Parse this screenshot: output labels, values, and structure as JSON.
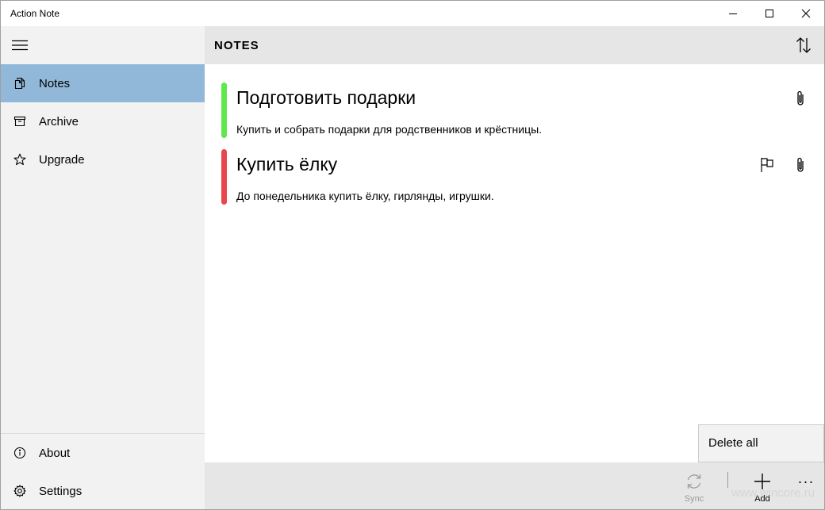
{
  "window": {
    "title": "Action Note"
  },
  "sidebar": {
    "items": [
      {
        "label": "Notes",
        "icon": "notes-icon",
        "active": true
      },
      {
        "label": "Archive",
        "icon": "archive-icon"
      },
      {
        "label": "Upgrade",
        "icon": "star-icon"
      }
    ],
    "footer": [
      {
        "label": "About",
        "icon": "info-icon"
      },
      {
        "label": "Settings",
        "icon": "gear-icon"
      }
    ]
  },
  "header": {
    "title": "NOTES"
  },
  "notes": [
    {
      "title": "Подготовить подарки",
      "body": "Купить и собрать подарки для родственников и крёстницы.",
      "color": "#5fe84c",
      "flagged": false,
      "attachment": true
    },
    {
      "title": "Купить ёлку",
      "body": "До понедельника купить ёлку, гирлянды, игрушки.",
      "color": "#e8474b",
      "flagged": true,
      "attachment": true
    }
  ],
  "popup": {
    "delete_all": "Delete all"
  },
  "commandbar": {
    "sync_label": "Sync",
    "add_label": "Add",
    "more": "···"
  },
  "watermark": "www.wincore.ru",
  "colors": {
    "accent": "#91b8d9",
    "sidebar_bg": "#f2f2f2",
    "header_bg": "#e6e6e6"
  }
}
